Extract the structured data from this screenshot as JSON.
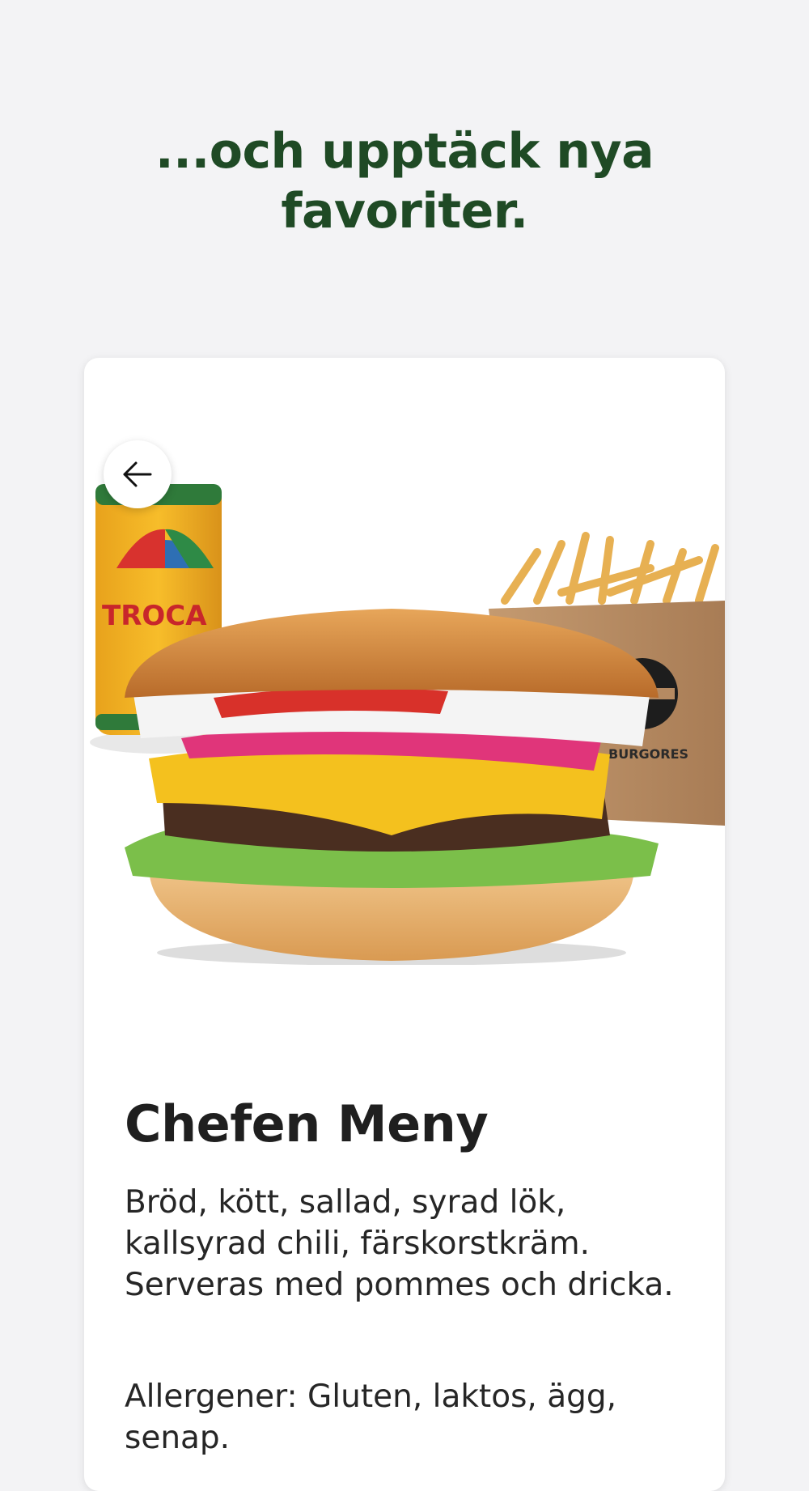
{
  "headline": "...och upptäck nya favoriter.",
  "card": {
    "back_icon": "arrow-left-icon",
    "product_image": {
      "items": [
        "burger",
        "soda-can",
        "fries-bag"
      ],
      "can_label": "TROCADERO",
      "bag_label": "BURGORES"
    },
    "title": "Chefen Meny",
    "description": "Bröd, kött, sallad, syrad lök, kallsyrad chili, färskorstkräm. Serveras med pommes och dricka.",
    "allergens": "Allergener: Gluten, laktos, ägg, senap."
  },
  "colors": {
    "headline": "#1f4a25",
    "background": "#f3f3f5"
  }
}
